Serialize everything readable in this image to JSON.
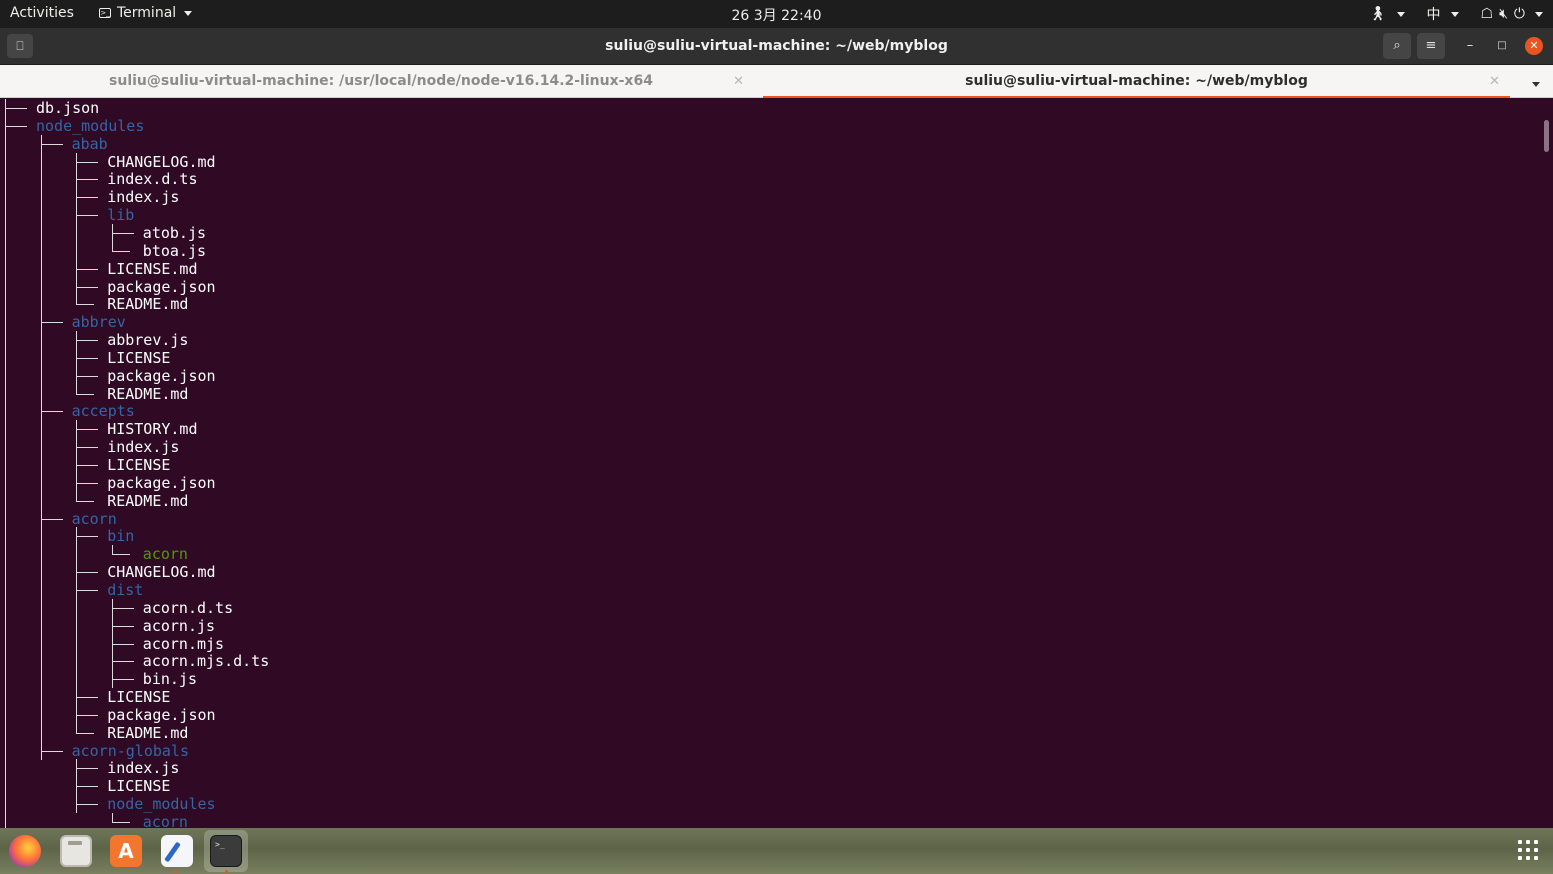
{
  "topbar": {
    "activities": "Activities",
    "app_name": "Terminal",
    "clock": "26 3月  22:40",
    "input_method": "中",
    "icons": [
      "accessibility-icon",
      "network-icon",
      "volume-icon",
      "power-icon"
    ]
  },
  "window": {
    "title": "suliu@suliu-virtual-machine: ~/web/myblog",
    "tabs": [
      {
        "label": "suliu@suliu-virtual-machine: /usr/local/node/node-v16.14.2-linux-x64",
        "active": false
      },
      {
        "label": "suliu@suliu-virtual-machine: ~/web/myblog",
        "active": true
      }
    ]
  },
  "colors": {
    "terminal_bg": "#300a24",
    "directory": "#3465a4",
    "executable": "#4e9a06",
    "file": "#ffffff",
    "accent": "#e95420"
  },
  "tree_lines": [
    {
      "depth": 0,
      "name": "db.json",
      "kind": "file",
      "last": false
    },
    {
      "depth": 0,
      "name": "node_modules",
      "kind": "dir",
      "last": false
    },
    {
      "depth": 1,
      "name": "abab",
      "kind": "dir",
      "last": false
    },
    {
      "depth": 2,
      "name": "CHANGELOG.md",
      "kind": "file",
      "last": false
    },
    {
      "depth": 2,
      "name": "index.d.ts",
      "kind": "file",
      "last": false
    },
    {
      "depth": 2,
      "name": "index.js",
      "kind": "file",
      "last": false
    },
    {
      "depth": 2,
      "name": "lib",
      "kind": "dir",
      "last": false
    },
    {
      "depth": 3,
      "name": "atob.js",
      "kind": "file",
      "last": false
    },
    {
      "depth": 3,
      "name": "btoa.js",
      "kind": "file",
      "last": true
    },
    {
      "depth": 2,
      "name": "LICENSE.md",
      "kind": "file",
      "last": false
    },
    {
      "depth": 2,
      "name": "package.json",
      "kind": "file",
      "last": false
    },
    {
      "depth": 2,
      "name": "README.md",
      "kind": "file",
      "last": true
    },
    {
      "depth": 1,
      "name": "abbrev",
      "kind": "dir",
      "last": false
    },
    {
      "depth": 2,
      "name": "abbrev.js",
      "kind": "file",
      "last": false
    },
    {
      "depth": 2,
      "name": "LICENSE",
      "kind": "file",
      "last": false
    },
    {
      "depth": 2,
      "name": "package.json",
      "kind": "file",
      "last": false
    },
    {
      "depth": 2,
      "name": "README.md",
      "kind": "file",
      "last": true
    },
    {
      "depth": 1,
      "name": "accepts",
      "kind": "dir",
      "last": false
    },
    {
      "depth": 2,
      "name": "HISTORY.md",
      "kind": "file",
      "last": false
    },
    {
      "depth": 2,
      "name": "index.js",
      "kind": "file",
      "last": false
    },
    {
      "depth": 2,
      "name": "LICENSE",
      "kind": "file",
      "last": false
    },
    {
      "depth": 2,
      "name": "package.json",
      "kind": "file",
      "last": false
    },
    {
      "depth": 2,
      "name": "README.md",
      "kind": "file",
      "last": true
    },
    {
      "depth": 1,
      "name": "acorn",
      "kind": "dir",
      "last": false
    },
    {
      "depth": 2,
      "name": "bin",
      "kind": "dir",
      "last": false
    },
    {
      "depth": 3,
      "name": "acorn",
      "kind": "exec",
      "last": true
    },
    {
      "depth": 2,
      "name": "CHANGELOG.md",
      "kind": "file",
      "last": false
    },
    {
      "depth": 2,
      "name": "dist",
      "kind": "dir",
      "last": false
    },
    {
      "depth": 3,
      "name": "acorn.d.ts",
      "kind": "file",
      "last": false
    },
    {
      "depth": 3,
      "name": "acorn.js",
      "kind": "file",
      "last": false
    },
    {
      "depth": 3,
      "name": "acorn.mjs",
      "kind": "file",
      "last": false
    },
    {
      "depth": 3,
      "name": "acorn.mjs.d.ts",
      "kind": "file",
      "last": false
    },
    {
      "depth": 3,
      "name": "bin.js",
      "kind": "file",
      "last": false
    },
    {
      "depth": 2,
      "name": "LICENSE",
      "kind": "file",
      "last": false
    },
    {
      "depth": 2,
      "name": "package.json",
      "kind": "file",
      "last": false
    },
    {
      "depth": 2,
      "name": "README.md",
      "kind": "file",
      "last": true
    },
    {
      "depth": 1,
      "name": "acorn-globals",
      "kind": "dir",
      "last": false
    },
    {
      "depth": 2,
      "name": "index.js",
      "kind": "file",
      "last": false
    },
    {
      "depth": 2,
      "name": "LICENSE",
      "kind": "file",
      "last": false
    },
    {
      "depth": 2,
      "name": "node_modules",
      "kind": "dir",
      "last": false
    },
    {
      "depth": 3,
      "name": "acorn",
      "kind": "dir",
      "last": true
    }
  ],
  "dock": {
    "apps": [
      "firefox-icon",
      "files-icon",
      "software-store-icon",
      "text-editor-icon",
      "terminal-icon"
    ],
    "show_apps": "show-applications-icon"
  }
}
